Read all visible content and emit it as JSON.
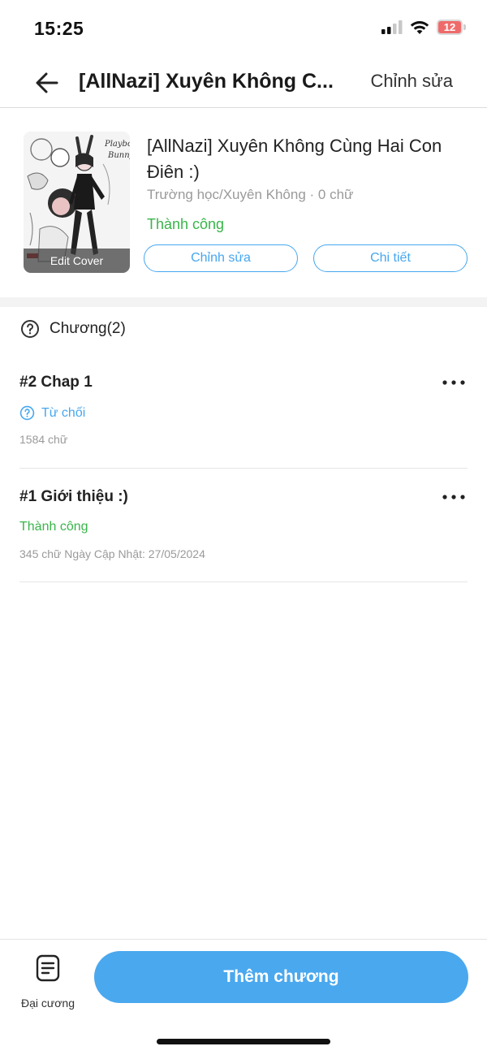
{
  "status_bar": {
    "time": "15:25",
    "battery": "12"
  },
  "nav": {
    "title": "[AllNazi] Xuyên Không C...",
    "edit_label": "Chỉnh sửa"
  },
  "story": {
    "title": "[AllNazi] Xuyên Không Cùng Hai Con Điên :)",
    "meta": "Trường học/Xuyên Không · 0 chữ",
    "status": "Thành công",
    "cover_label": "Edit Cover",
    "cover_text": [
      "Playboy",
      "Bunny"
    ],
    "edit_button": "Chỉnh sửa",
    "detail_button": "Chi tiết"
  },
  "chapters": {
    "header": "Chương(2)",
    "items": [
      {
        "title": "#2 Chap 1",
        "status": "Từ chối",
        "meta": "1584 chữ"
      },
      {
        "title": "#1 Giới thiệu :)",
        "status": "Thành công",
        "meta": "345 chữ Ngày Cập Nhật: 27/05/2024"
      }
    ]
  },
  "bottom": {
    "outline_label": "Đại cương",
    "add_chapter": "Thêm chương"
  },
  "colors": {
    "accent": "#4aa8ee",
    "success": "#39b54a",
    "rejected": "#46a7ef",
    "battery": "#ef6b6b"
  }
}
